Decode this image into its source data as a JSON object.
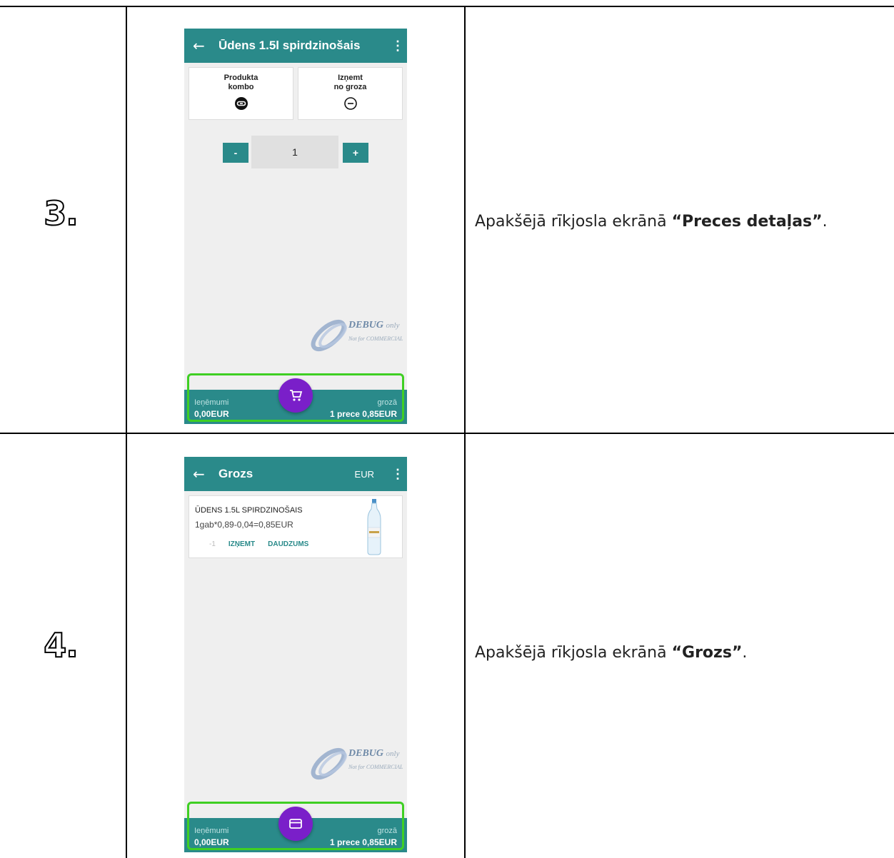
{
  "rows": [
    {
      "step": "3.",
      "description_prefix": "Apakšējā rīkjosla ekrānā ",
      "description_bold": "“Preces detaļas”",
      "description_suffix": ".",
      "screen": {
        "title": "Ūdens 1.5l spirdzinošais",
        "back_icon": "arrow-left-icon",
        "menu_icon": "more-vert-icon",
        "card1_line1": "Produkta",
        "card1_line2": "kombo",
        "card2_line1": "Izņemt",
        "card2_line2": "no groza",
        "qty_minus": "-",
        "qty_value": "1",
        "qty_plus": "+",
        "watermark_main": "DEBUG",
        "watermark_only": "only",
        "watermark_sub": "Not for COMMERCIAL",
        "bottom_left_label": "Ieņēmumi",
        "bottom_left_value": "0,00EUR",
        "bottom_right_label": "grozā",
        "bottom_right_value": "1 prece 0,85EUR",
        "fab_icon": "cart-icon"
      }
    },
    {
      "step": "4.",
      "description_prefix": "Apakšējā rīkjosla ekrānā ",
      "description_bold": "“Grozs”",
      "description_suffix": ".",
      "screen": {
        "title": "Grozs",
        "currency": "EUR",
        "back_icon": "arrow-left-icon",
        "menu_icon": "more-vert-icon",
        "item_name": "ŪDENS 1.5L SPIRDZINOŠAIS",
        "item_calc": "1gab*0,89-0,04=0,85EUR",
        "item_minus": "-1",
        "item_remove": "IZŅEMT",
        "item_qty": "DAUDZUMS",
        "watermark_main": "DEBUG",
        "watermark_only": "only",
        "watermark_sub": "Not for COMMERCIAL",
        "bottom_left_label": "Ieņēmumi",
        "bottom_left_value": "0,00EUR",
        "bottom_right_label": "grozā",
        "bottom_right_value": "1 prece 0,85EUR",
        "fab_icon": "credit-card-icon"
      }
    }
  ],
  "colors": {
    "teal": "#2a8a8a",
    "purple": "#7a1fc9",
    "highlight_green": "#3fcf23"
  }
}
